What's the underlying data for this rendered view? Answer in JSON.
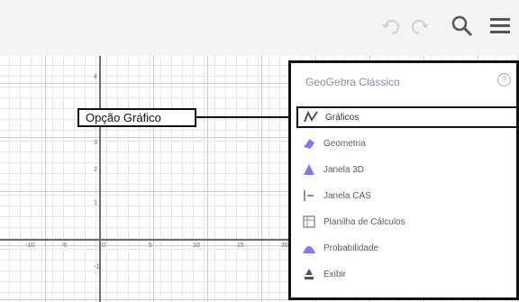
{
  "toolbar": {
    "undo_icon": "undo-icon",
    "redo_icon": "redo-icon",
    "search_icon": "search-icon",
    "menu_icon": "hamburger-menu-icon"
  },
  "graph": {
    "y_ticks": [
      "4",
      "3",
      "2",
      "1",
      "-1"
    ],
    "x_ticks": [
      "-10",
      "-5",
      "0",
      "5",
      "10",
      "15",
      "20"
    ]
  },
  "callout": {
    "label": "Opção Gráfico"
  },
  "menu": {
    "title": "GeoGebra Clássico",
    "help_icon": "help-icon",
    "items": [
      {
        "label": "Gráficos",
        "icon": "graphing-icon",
        "active": true
      },
      {
        "label": "Geometria",
        "icon": "geometry-icon",
        "active": false
      },
      {
        "label": "Janela 3D",
        "icon": "3d-window-icon",
        "active": false
      },
      {
        "label": "Janela CAS",
        "icon": "cas-icon",
        "active": false
      },
      {
        "label": "Planilha de Cálculos",
        "icon": "spreadsheet-icon",
        "active": false
      },
      {
        "label": "Probabilidade",
        "icon": "probability-icon",
        "active": false
      },
      {
        "label": "Exibir",
        "icon": "exibir-icon",
        "active": false
      }
    ]
  },
  "colors": {
    "accent": "#7b79ff",
    "icon_gray": "#b9b9b9",
    "text_muted": "#8a8fa8"
  }
}
